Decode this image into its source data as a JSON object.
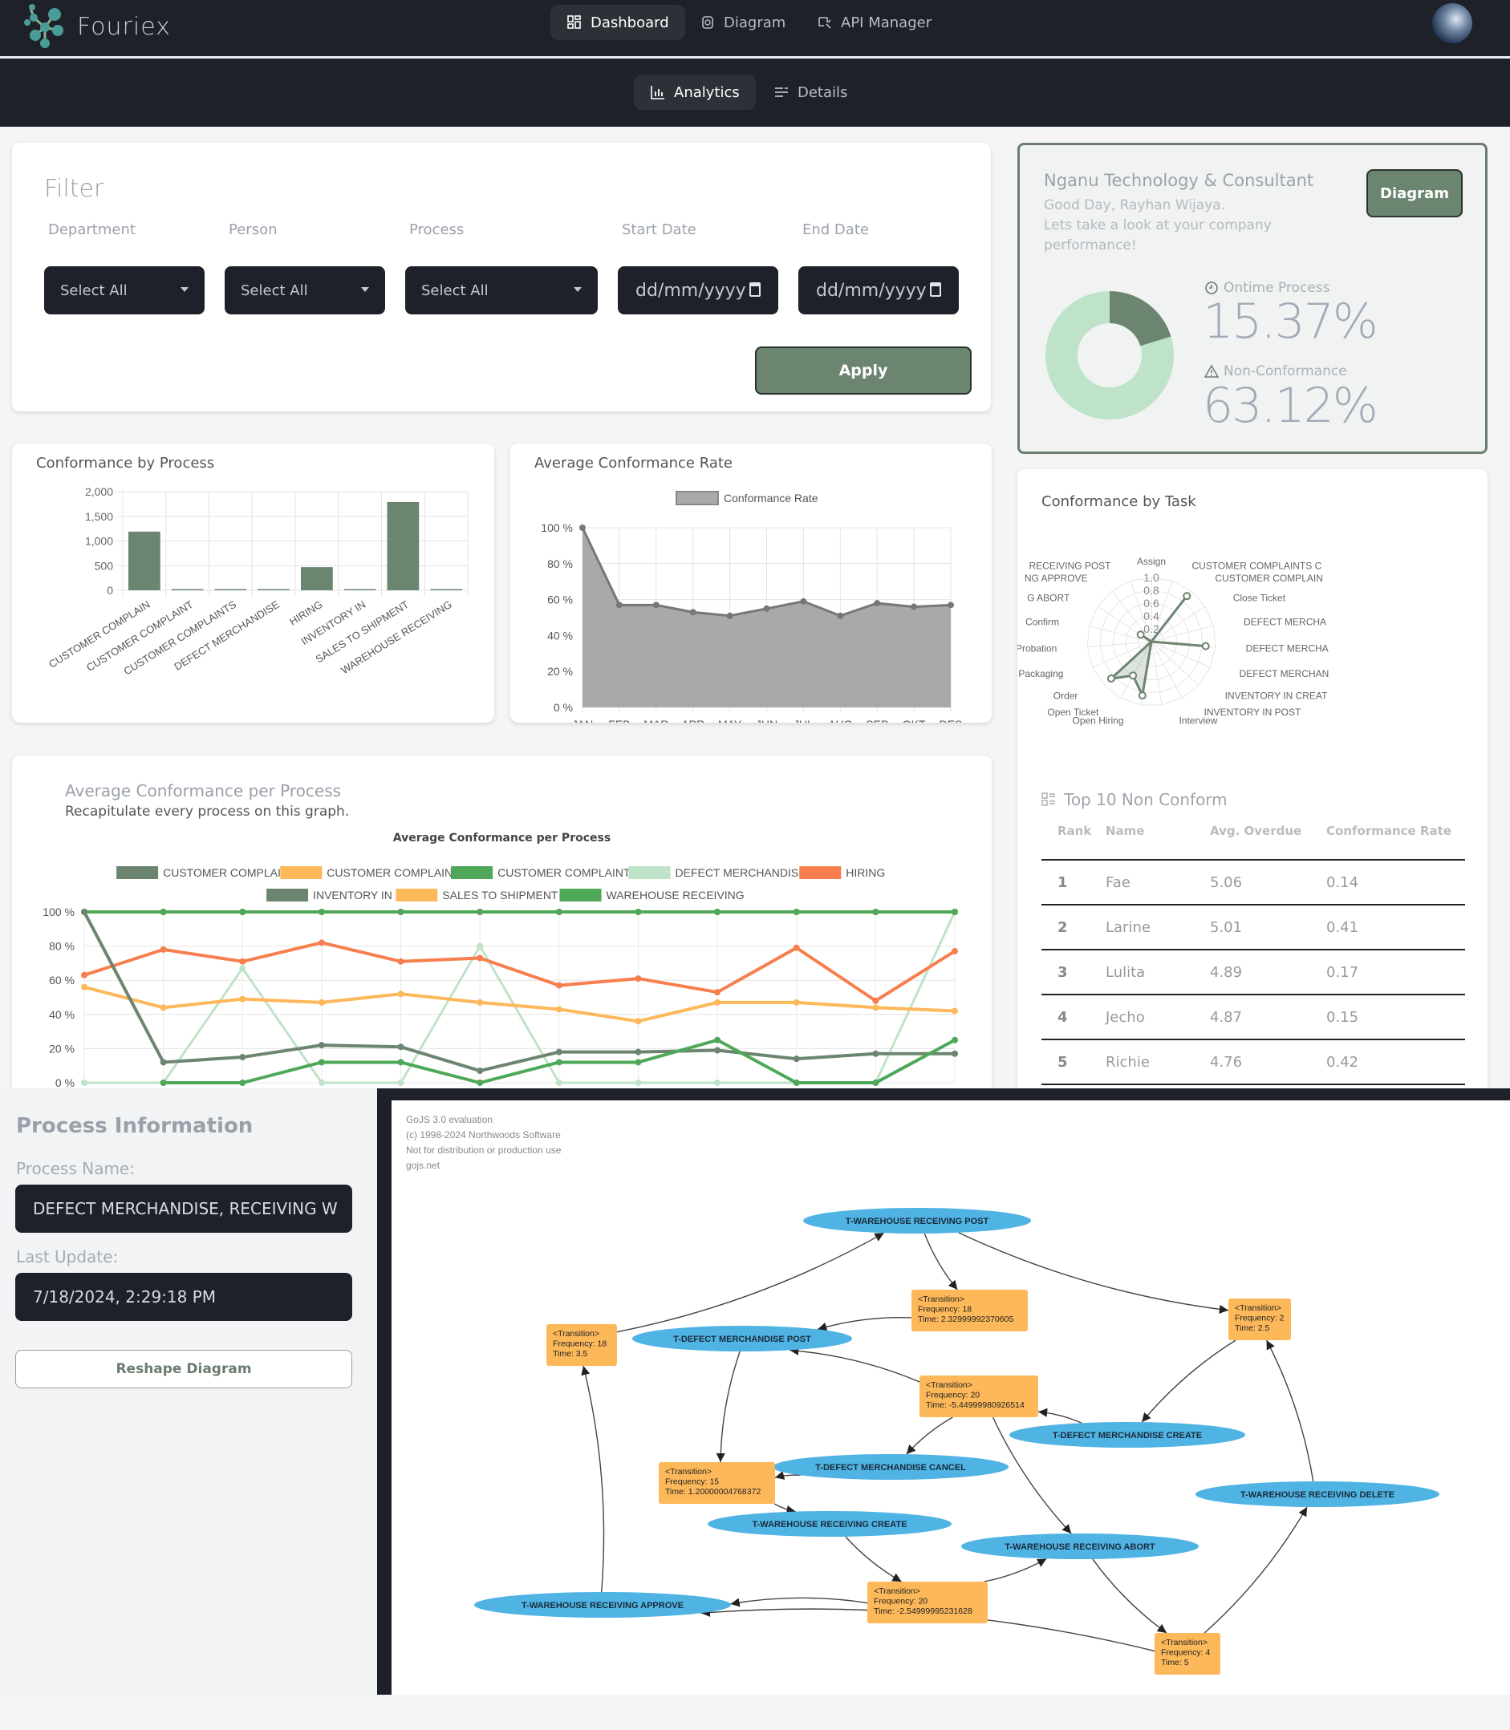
{
  "app": {
    "brand": "Fouriex",
    "nav_tabs": [
      {
        "label": "Dashboard",
        "icon": "grid-icon",
        "active": true
      },
      {
        "label": "Diagram",
        "icon": "diagram-icon",
        "active": false
      },
      {
        "label": "API Manager",
        "icon": "plug-icon",
        "active": false
      }
    ],
    "sub_tabs": [
      {
        "label": "Analytics",
        "icon": "bar-chart-icon",
        "active": true
      },
      {
        "label": "Details",
        "icon": "list-icon",
        "active": false
      }
    ]
  },
  "filter": {
    "title": "Filter",
    "fields": [
      {
        "label": "Department",
        "value": "Select All",
        "type": "select"
      },
      {
        "label": "Person",
        "value": "Select All",
        "type": "select"
      },
      {
        "label": "Process",
        "value": "Select All",
        "type": "select"
      },
      {
        "label": "Start Date",
        "value": "dd/mm/yyyy",
        "type": "date"
      },
      {
        "label": "End Date",
        "value": "dd/mm/yyyy",
        "type": "date"
      }
    ],
    "apply_label": "Apply"
  },
  "company": {
    "name": "Nganu Technology & Consultant",
    "greeting": "Good Day, Rayhan Wijaya.",
    "message": "Lets take a look at your company performance!",
    "diagram_button": "Diagram",
    "ontime_label": "Ontime Process",
    "ontime_value": "15.37%",
    "nonconf_label": "Non-Conformance",
    "nonconf_value": "63.12%",
    "donut": {
      "ontime_fraction": 0.1537,
      "colors": {
        "ontime": "#6b8570",
        "rest": "#bfe3c8"
      }
    }
  },
  "tasks_card": {
    "title": "Conformance by Task",
    "table_title": "Top 10 Non Conform",
    "columns": [
      "Rank",
      "Name",
      "Avg. Overdue",
      "Conformance Rate"
    ],
    "rows": [
      {
        "rank": "1",
        "name": "Fae",
        "overdue": "5.06",
        "rate": "0.14"
      },
      {
        "rank": "2",
        "name": "Larine",
        "overdue": "5.01",
        "rate": "0.41"
      },
      {
        "rank": "3",
        "name": "Lulita",
        "overdue": "4.89",
        "rate": "0.17"
      },
      {
        "rank": "4",
        "name": "Jecho",
        "overdue": "4.87",
        "rate": "0.15"
      },
      {
        "rank": "5",
        "name": "Richie",
        "overdue": "4.76",
        "rate": "0.42"
      }
    ]
  },
  "avg_process_card": {
    "title": "Average Conformance per Process",
    "subtitle": "Recapitulate every process on this graph."
  },
  "process_info": {
    "title": "Process Information",
    "name_label": "Process Name:",
    "name_value": "DEFECT MERCHANDISE, RECEIVING W",
    "update_label": "Last Update:",
    "update_value": "7/18/2024, 2:29:18 PM",
    "reshape_label": "Reshape Diagram"
  },
  "gojs": {
    "watermark": [
      "GoJS 3.0 evaluation",
      "(c) 1998-2024 Northwoods Software",
      "Not for distribution or production use",
      "gojs.net"
    ],
    "nodes": [
      {
        "id": "wrpost",
        "label": "T-WAREHOUSE RECEIVING POST",
        "kind": "state"
      },
      {
        "id": "dmpost",
        "label": "T-DEFECT MERCHANDISE POST",
        "kind": "state"
      },
      {
        "id": "dmcreate",
        "label": "T-DEFECT MERCHANDISE CREATE",
        "kind": "state"
      },
      {
        "id": "dmcancel",
        "label": "T-DEFECT MERCHANDISE CANCEL",
        "kind": "state"
      },
      {
        "id": "wrdelete",
        "label": "T-WAREHOUSE RECEIVING DELETE",
        "kind": "state"
      },
      {
        "id": "wrcreate",
        "label": "T-WAREHOUSE RECEIVING CREATE",
        "kind": "state"
      },
      {
        "id": "wrabort",
        "label": "T-WAREHOUSE RECEIVING ABORT",
        "kind": "state"
      },
      {
        "id": "wrapprove",
        "label": "T-WAREHOUSE RECEIVING APPROVE",
        "kind": "state"
      },
      {
        "id": "t1",
        "label": [
          "<Transition>",
          "Frequency: 18",
          "Time: 3.5"
        ],
        "kind": "transition"
      },
      {
        "id": "t2",
        "label": [
          "<Transition>",
          "Frequency: 18",
          "Time: 2.32999992370605"
        ],
        "kind": "transition"
      },
      {
        "id": "t3",
        "label": [
          "<Transition>",
          "Frequency: 2",
          "Time: 2.5"
        ],
        "kind": "transition"
      },
      {
        "id": "t4",
        "label": [
          "<Transition>",
          "Frequency: 20",
          "Time: -5.44999980926514"
        ],
        "kind": "transition"
      },
      {
        "id": "t5",
        "label": [
          "<Transition>",
          "Frequency: 15",
          "Time: 1.20000004768372"
        ],
        "kind": "transition"
      },
      {
        "id": "t6",
        "label": [
          "<Transition>",
          "Frequency: 20",
          "Time: -2.54999995231628"
        ],
        "kind": "transition"
      },
      {
        "id": "t7",
        "label": [
          "<Transition>",
          "Frequency: 4",
          "Time: 5"
        ],
        "kind": "transition"
      }
    ],
    "edges": [
      [
        "t1",
        "wrpost"
      ],
      [
        "wrpost",
        "t2"
      ],
      [
        "wrpost",
        "t3"
      ],
      [
        "t2",
        "dmpost"
      ],
      [
        "t4",
        "dmpost"
      ],
      [
        "dmpost",
        "t5"
      ],
      [
        "dmcreate",
        "t4"
      ],
      [
        "t3",
        "dmcreate"
      ],
      [
        "t4",
        "dmcancel"
      ],
      [
        "t4",
        "wrabort"
      ],
      [
        "dmcancel",
        "t5"
      ],
      [
        "t5",
        "wrcreate"
      ],
      [
        "wrcreate",
        "t6"
      ],
      [
        "t6",
        "wrabort"
      ],
      [
        "t6",
        "wrapprove"
      ],
      [
        "wrapprove",
        "t1"
      ],
      [
        "wrabort",
        "t7"
      ],
      [
        "t7",
        "wrapprove"
      ],
      [
        "t7",
        "wrdelete"
      ],
      [
        "wrdelete",
        "t3"
      ]
    ],
    "colors": {
      "state": "#4fb3e3",
      "transition": "#fdb85a"
    }
  },
  "chart_data": [
    {
      "type": "bar",
      "title": "Conformance by Process",
      "categories": [
        "CUSTOMER COMPLAIN",
        "CUSTOMER COMPLAINT",
        "CUSTOMER COMPLAINTS",
        "DEFECT MERCHANDISE",
        "HIRING",
        "INVENTORY IN",
        "SALES TO SHIPMENT",
        "WAREHOUSE RECEIVING"
      ],
      "values": [
        1190,
        5,
        10,
        10,
        470,
        10,
        1790,
        10
      ],
      "yticks": [
        "0",
        "500",
        "1,000",
        "1,500",
        "2,000"
      ],
      "ylim": [
        0,
        2000
      ],
      "grid": true,
      "color": "#6b8570"
    },
    {
      "type": "area",
      "title": "Average Conformance Rate",
      "legend": [
        "Conformance Rate"
      ],
      "legend_position": "top",
      "categories": [
        "JAN",
        "FEB",
        "MAR",
        "APR",
        "MAY",
        "JUN",
        "JUL",
        "AUG",
        "SEP",
        "OKT",
        "DES"
      ],
      "values": [
        100,
        57,
        57,
        53,
        51,
        55,
        59,
        51,
        58,
        56,
        57
      ],
      "yticks": [
        "0 %",
        "20 %",
        "40 %",
        "60 %",
        "80 %",
        "100 %"
      ],
      "ylim": [
        0,
        100
      ],
      "grid": true,
      "color": "#a9a9a9"
    },
    {
      "type": "radar",
      "title": "Conformance by Task",
      "labels": [
        "Assign",
        "CUSTOMER COMPLAINTS C",
        "CUSTOMER COMPLAIN",
        "Close Ticket",
        "DEFECT MERCHA",
        "DEFECT MERCHA",
        "DEFECT MERCHAN",
        "INVENTORY IN CREAT",
        "INVENTORY IN POST",
        "Interview",
        "Open Hiring",
        "Open Ticket",
        "Order",
        "Packaging",
        "Probation",
        "Confirm",
        "G ABORT",
        "NG APPROVE",
        "RECEIVING POST"
      ],
      "values": [
        0.0,
        0.0,
        0.9,
        0.0,
        0.0,
        0.85,
        0.0,
        0.0,
        0.0,
        0.0,
        0.85,
        0.6,
        0.85,
        0.0,
        0.0,
        0.0,
        0.2,
        0.0,
        0.0
      ],
      "rticks": [
        "0.2",
        "0.4",
        "0.6",
        "0.8",
        "1.0"
      ],
      "rlim": [
        0,
        1
      ],
      "color": "#6b8570"
    },
    {
      "type": "line",
      "title": "Average Conformance per Process",
      "legend_position": "top",
      "x": [
        "1",
        "2",
        "3",
        "4",
        "5",
        "6",
        "7",
        "8",
        "9",
        "10",
        "11",
        "12"
      ],
      "yticks": [
        "0 %",
        "20 %",
        "40 %",
        "60 %",
        "80 %",
        "100 %"
      ],
      "ylim": [
        0,
        100
      ],
      "series": [
        {
          "name": "CUSTOMER COMPLAIN",
          "color": "#6b8570",
          "values": [
            100,
            100,
            100,
            100,
            100,
            100,
            100,
            100,
            100,
            100,
            100,
            100
          ]
        },
        {
          "name": "CUSTOMER COMPLAINT",
          "color": "#fdb85a",
          "values": [
            100,
            100,
            100,
            100,
            100,
            100,
            100,
            100,
            100,
            100,
            100,
            100
          ]
        },
        {
          "name": "CUSTOMER COMPLAINTS",
          "color": "#4ea857",
          "values": [
            100,
            100,
            100,
            100,
            100,
            100,
            100,
            100,
            100,
            100,
            100,
            100
          ]
        },
        {
          "name": "DEFECT MERCHANDISE",
          "color": "#bfe3c8",
          "values": [
            0,
            0,
            67,
            0,
            0,
            80,
            0,
            0,
            0,
            0,
            0,
            100
          ]
        },
        {
          "name": "HIRING",
          "color": "#f77f4f",
          "values": [
            63,
            78,
            71,
            82,
            71,
            73,
            57,
            61,
            53,
            79,
            48,
            77
          ]
        },
        {
          "name": "INVENTORY IN",
          "color": "#6b8570",
          "values": [
            100,
            12,
            15,
            22,
            21,
            7,
            18,
            18,
            19,
            14,
            17,
            17
          ]
        },
        {
          "name": "SALES TO SHIPMENT",
          "color": "#fdb85a",
          "values": [
            56,
            44,
            49,
            47,
            52,
            47,
            43,
            36,
            47,
            47,
            44,
            42
          ]
        },
        {
          "name": "WAREHOUSE RECEIVING",
          "color": "#4ea857",
          "values": [
            null,
            0,
            0,
            12,
            12,
            0,
            12,
            12,
            25,
            0,
            0,
            25
          ]
        }
      ]
    }
  ]
}
